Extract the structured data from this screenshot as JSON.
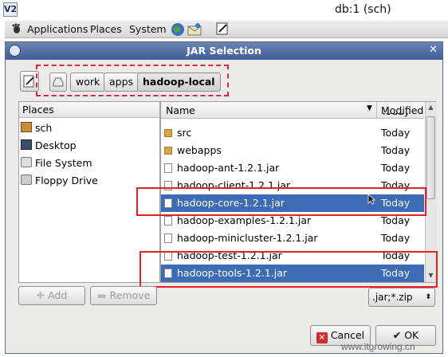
{
  "vnc": {
    "logo": "V2",
    "title": "db:1 (sch)"
  },
  "panel": {
    "applications": "Applications",
    "places": "Places",
    "system": "System"
  },
  "dialog": {
    "title": "JAR Selection",
    "breadcrumbs": [
      "work",
      "apps",
      "hadoop-local"
    ],
    "places_header": "Places",
    "places": [
      {
        "label": "sch",
        "icon": "home-icon"
      },
      {
        "label": "Desktop",
        "icon": "desktop-icon"
      },
      {
        "label": "File System",
        "icon": "drive-icon"
      },
      {
        "label": "Floppy Drive",
        "icon": "floppy-icon"
      }
    ],
    "columns": {
      "name": "Name",
      "modified": "Modified"
    },
    "partial_row_modified": "Today",
    "files": [
      {
        "name": "src",
        "modified": "Today",
        "type": "folder",
        "selected": false
      },
      {
        "name": "webapps",
        "modified": "Today",
        "type": "folder",
        "selected": false
      },
      {
        "name": "hadoop-ant-1.2.1.jar",
        "modified": "Today",
        "type": "file",
        "selected": false
      },
      {
        "name": "hadoop-client-1.2.1.jar",
        "modified": "Today",
        "type": "file",
        "selected": false
      },
      {
        "name": "hadoop-core-1.2.1.jar",
        "modified": "Today",
        "type": "file",
        "selected": true
      },
      {
        "name": "hadoop-examples-1.2.1.jar",
        "modified": "Today",
        "type": "file",
        "selected": false
      },
      {
        "name": "hadoop-minicluster-1.2.1.jar",
        "modified": "Today",
        "type": "file",
        "selected": false
      },
      {
        "name": "hadoop-test-1.2.1.jar",
        "modified": "Today",
        "type": "file",
        "selected": false
      },
      {
        "name": "hadoop-tools-1.2.1.jar",
        "modified": "Today",
        "type": "file",
        "selected": true
      }
    ],
    "add_label": "Add",
    "remove_label": "Remove",
    "filter": ".jar;*.zip",
    "cancel_label": "Cancel",
    "ok_label": "OK"
  },
  "watermark": "www.itgrowing.cn",
  "colors": {
    "selection": "#3d6cb4",
    "highlight_box": "#e0202a",
    "titlebar": "#4f6ea4"
  }
}
